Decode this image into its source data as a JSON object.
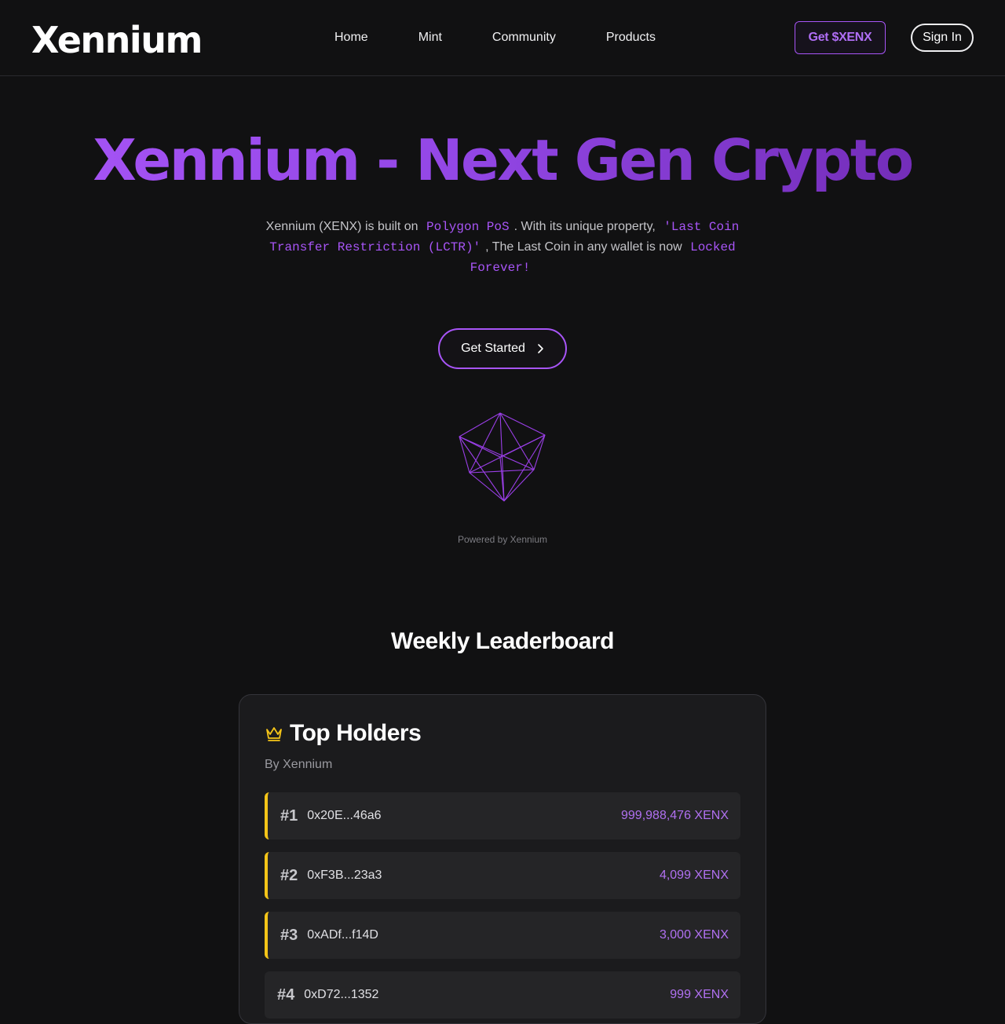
{
  "header": {
    "logo": "Xennium",
    "nav": [
      "Home",
      "Mint",
      "Community",
      "Products"
    ],
    "get_button": "Get $XENX",
    "signin_button": "Sign In"
  },
  "hero": {
    "title": "Xennium - Next Gen Crypto",
    "desc_1": "Xennium (XENX) is built on",
    "desc_code_1": "Polygon PoS",
    "desc_2": ". With its unique property,",
    "desc_code_2": "'Last Coin Transfer Restriction (LCTR)'",
    "desc_3": ", The Last Coin in any wallet is now",
    "desc_code_3": "Locked Forever!",
    "cta": "Get Started",
    "powered_by": "Powered by Xennium"
  },
  "leaderboard": {
    "section_title": "Weekly Leaderboard",
    "card_title": "Top Holders",
    "card_subtitle": "By Xennium",
    "rows": [
      {
        "rank": "#1",
        "address": "0x20E...46a6",
        "amount": "999,988,476 XENX"
      },
      {
        "rank": "#2",
        "address": "0xF3B...23a3",
        "amount": "4,099 XENX"
      },
      {
        "rank": "#3",
        "address": "0xADf...f14D",
        "amount": "3,000 XENX"
      },
      {
        "rank": "#4",
        "address": "0xD72...1352",
        "amount": "999 XENX"
      }
    ]
  },
  "colors": {
    "accent": "#a855f7",
    "gold": "#f5c518",
    "background": "#111112"
  },
  "icons": [
    "chevron-right-icon",
    "crown-icon",
    "crystal-wireframe-icon"
  ]
}
